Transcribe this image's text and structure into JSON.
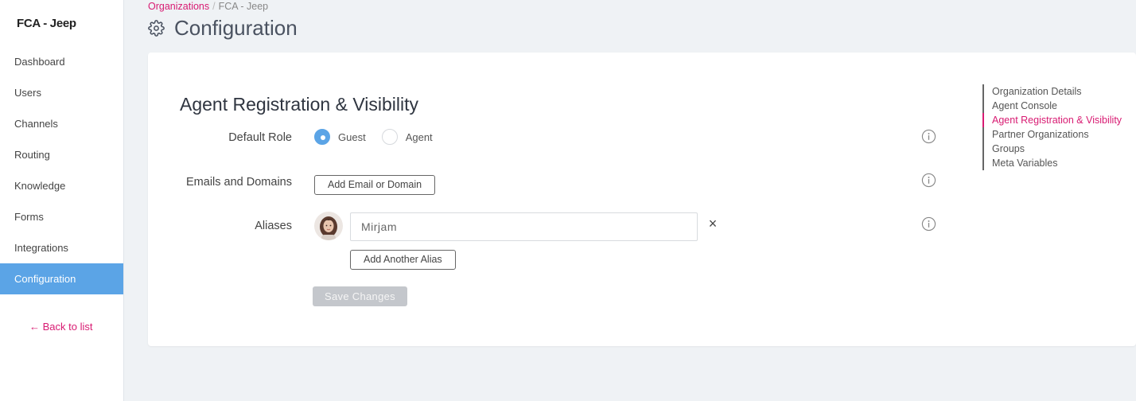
{
  "sidebar": {
    "org_name": "FCA - Jeep",
    "items": [
      {
        "label": "Dashboard"
      },
      {
        "label": "Users"
      },
      {
        "label": "Channels"
      },
      {
        "label": "Routing"
      },
      {
        "label": "Knowledge"
      },
      {
        "label": "Forms"
      },
      {
        "label": "Integrations"
      },
      {
        "label": "Configuration",
        "active": true
      }
    ],
    "back_link": "← Back to list"
  },
  "breadcrumb": {
    "parent": "Organizations",
    "separator": "/",
    "current": "FCA - Jeep"
  },
  "page": {
    "title": "Configuration",
    "icon": "gear-icon"
  },
  "section": {
    "title": "Agent Registration & Visibility",
    "default_role": {
      "label": "Default Role",
      "options": [
        {
          "label": "Guest",
          "checked": true
        },
        {
          "label": "Agent",
          "checked": false
        }
      ]
    },
    "emails_domains": {
      "label": "Emails and Domains",
      "button": "Add Email or Domain"
    },
    "aliases": {
      "label": "Aliases",
      "value": "Mirjam",
      "remove": "×",
      "add_button": "Add Another Alias"
    },
    "save_button": "Save Changes"
  },
  "toc": {
    "items": [
      {
        "label": "Organization Details"
      },
      {
        "label": "Agent Console"
      },
      {
        "label": "Agent Registration & Visibility",
        "active": true
      },
      {
        "label": "Partner Organizations"
      },
      {
        "label": "Groups"
      },
      {
        "label": "Meta Variables"
      }
    ]
  },
  "colors": {
    "accent": "#d81b72",
    "active_nav": "#5ba4e6",
    "background": "#eff2f5"
  }
}
